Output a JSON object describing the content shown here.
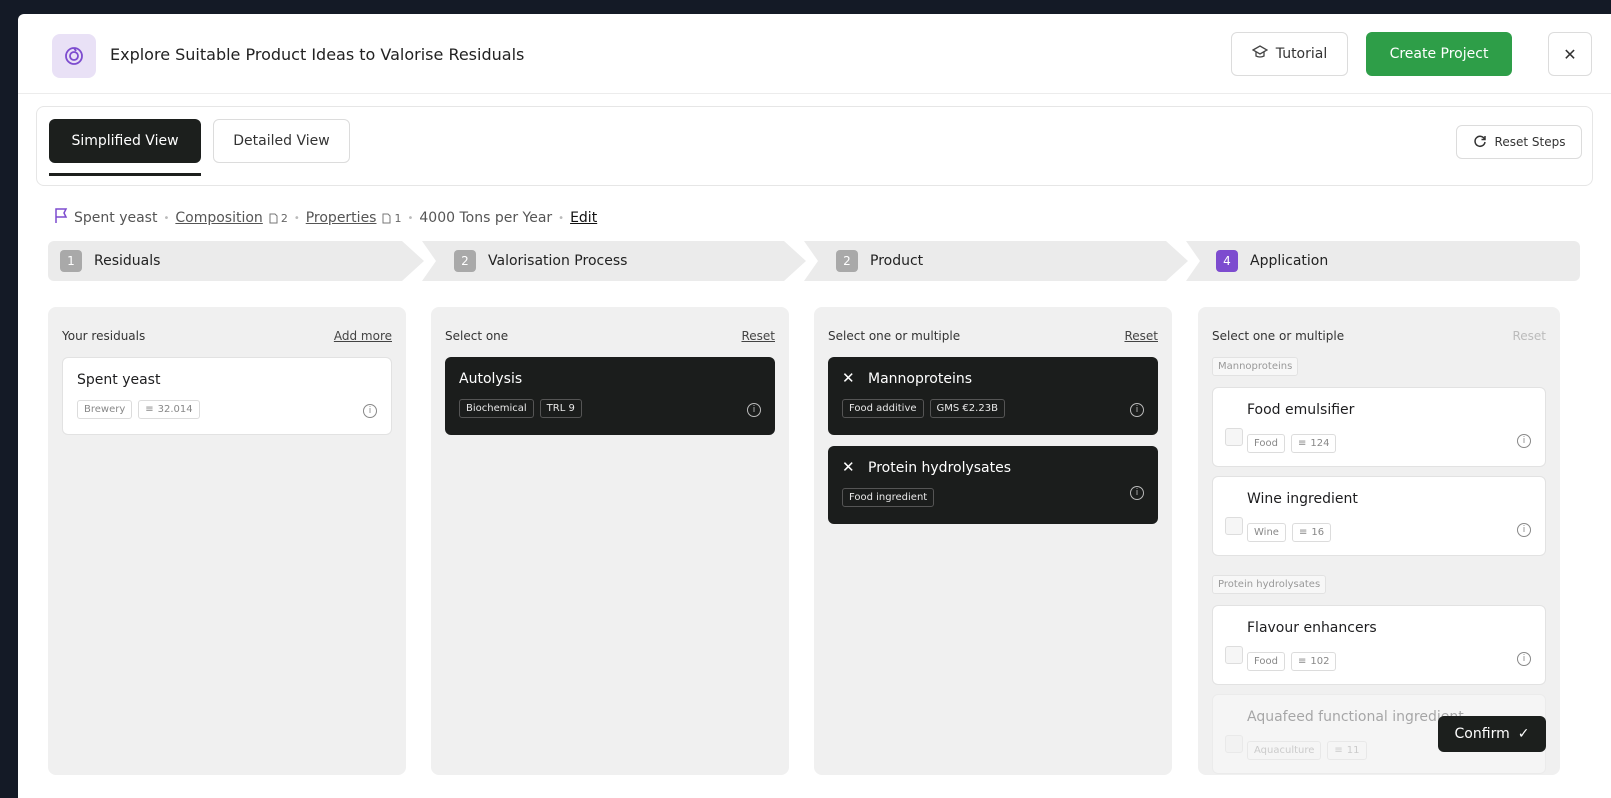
{
  "header": {
    "title": "Explore Suitable Product Ideas to Valorise Residuals",
    "tutorial_label": "Tutorial",
    "create_label": "Create Project",
    "close_symbol": "✕"
  },
  "views": {
    "simplified": "Simplified View",
    "detailed": "Detailed View",
    "reset_steps": "Reset Steps"
  },
  "breadcrumb": {
    "residual": "Spent yeast",
    "composition": "Composition",
    "composition_count": "2",
    "properties": "Properties",
    "properties_count": "1",
    "volume": "4000 Tons per Year",
    "edit": "Edit"
  },
  "steps": [
    {
      "num": "1",
      "label": "Residuals"
    },
    {
      "num": "2",
      "label": "Valorisation Process"
    },
    {
      "num": "2",
      "label": "Product"
    },
    {
      "num": "4",
      "label": "Application"
    }
  ],
  "residuals": {
    "heading": "Your residuals",
    "action": "Add more",
    "cards": [
      {
        "title": "Spent yeast",
        "tag1": "Brewery",
        "tag2": "32.014"
      }
    ]
  },
  "process": {
    "heading": "Select one",
    "action": "Reset",
    "cards": [
      {
        "title": "Autolysis",
        "tag1": "Biochemical",
        "tag2": "TRL 9"
      }
    ]
  },
  "product": {
    "heading": "Select one or multiple",
    "action": "Reset",
    "cards": [
      {
        "title": "Mannoproteins",
        "tag1": "Food additive",
        "tag2": "GMS €2.23B"
      },
      {
        "title": "Protein hydrolysates",
        "tag1": "Food ingredient"
      }
    ]
  },
  "application": {
    "heading": "Select one or multiple",
    "action": "Reset",
    "groups": [
      {
        "label": "Mannoproteins",
        "items": [
          {
            "title": "Food emulsifier",
            "tag1": "Food",
            "tag2": "124"
          },
          {
            "title": "Wine ingredient",
            "tag1": "Wine",
            "tag2": "16"
          }
        ]
      },
      {
        "label": "Protein hydrolysates",
        "items": [
          {
            "title": "Flavour enhancers",
            "tag1": "Food",
            "tag2": "102"
          },
          {
            "title": "Aquafeed functional ingredient",
            "tag1": "Aquaculture",
            "tag2": "11"
          }
        ]
      }
    ],
    "confirm": "Confirm"
  },
  "colors": {
    "accent": "#7d4ccf",
    "create": "#2e9e48",
    "dark": "#1b1d1c"
  }
}
